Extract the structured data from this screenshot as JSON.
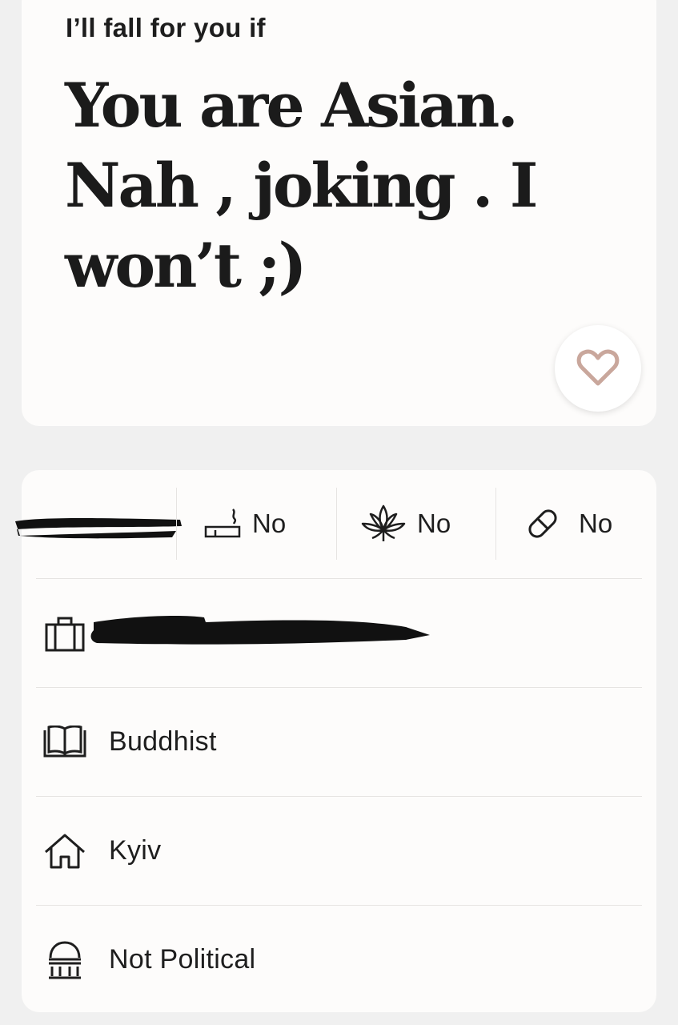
{
  "prompt": {
    "question": "I’ll fall for you if",
    "answer_lines": [
      "You are Asian.",
      "Nah , joking . I",
      "won’t ;)"
    ]
  },
  "like_button": {
    "icon": "heart-icon",
    "color": "#c9a79c"
  },
  "vitals": {
    "smoking": {
      "icon": "cigarette-icon",
      "value": "No"
    },
    "marijuana": {
      "icon": "cannabis-leaf-icon",
      "value": "No"
    },
    "drugs": {
      "icon": "pill-icon",
      "value": "No"
    }
  },
  "details": {
    "job": {
      "icon": "briefcase-icon"
    },
    "religion": {
      "icon": "book-icon",
      "value": "Buddhist"
    },
    "hometown": {
      "icon": "house-icon",
      "value": "Kyiv"
    },
    "politics": {
      "icon": "capitol-icon",
      "value": "Not Political"
    }
  },
  "colors": {
    "background": "#f0f0f0",
    "card": "#fdfcfb",
    "text": "#1c1c1c",
    "heart": "#c9a79c"
  }
}
